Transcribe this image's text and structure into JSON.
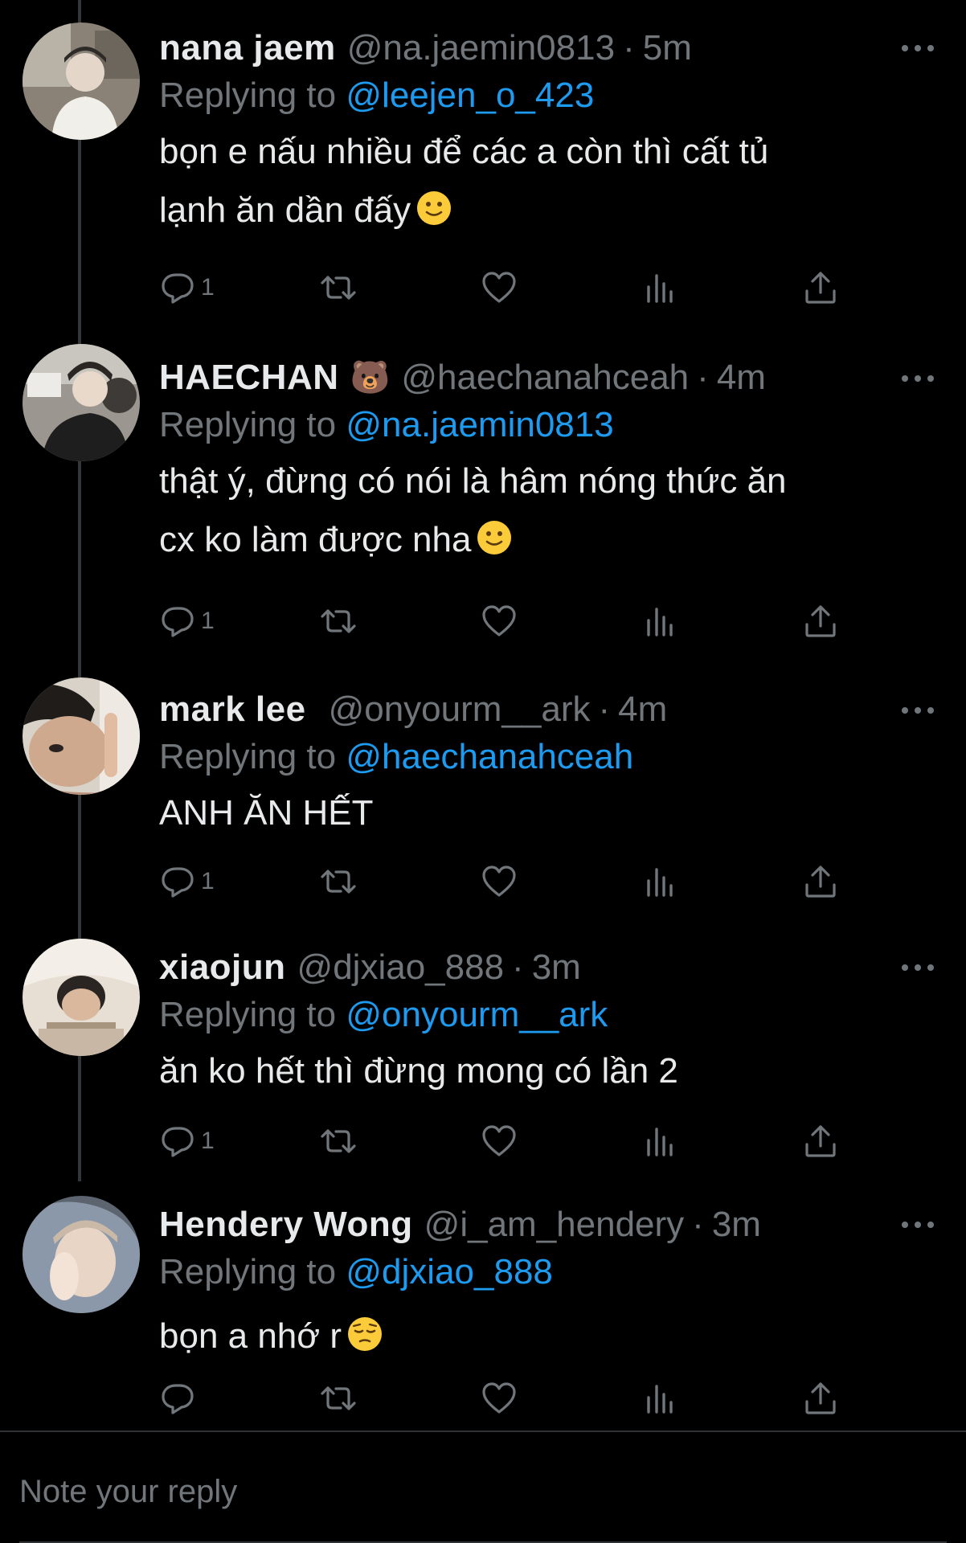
{
  "tweets": [
    {
      "name": "nana jaem",
      "name_emoji": "",
      "handle": "@na.jaemin0813",
      "separator": "·",
      "time": "5m",
      "replying_prefix": "Replying to",
      "replying_to": "@leejen_o_423",
      "text_lines": [
        "bọn e nấu nhiều để các a còn thì cất tủ",
        "lạnh ăn dần đấy"
      ],
      "text_emoji": "slightly-smiling-face",
      "reply_count": "1"
    },
    {
      "name": "HAECHAN",
      "name_emoji": "🐻",
      "handle": "@haechanahceah",
      "separator": "·",
      "time": "4m",
      "replying_prefix": "Replying to",
      "replying_to": "@na.jaemin0813",
      "text_lines": [
        "thật ý, đừng có nói là hâm nóng thức ăn",
        "cx ko làm được nha"
      ],
      "text_emoji": "slightly-smiling-face",
      "reply_count": "1"
    },
    {
      "name": "mark lee",
      "name_emoji": "",
      "handle": "@onyourm__ark",
      "separator": "·",
      "time": "4m",
      "replying_prefix": "Replying to",
      "replying_to": "@haechanahceah",
      "text_lines": [
        "ANH ĂN HẾT"
      ],
      "text_emoji": "",
      "reply_count": "1"
    },
    {
      "name": "xiaojun",
      "name_emoji": "",
      "handle": "@djxiao_888",
      "separator": "·",
      "time": "3m",
      "replying_prefix": "Replying to",
      "replying_to": "@onyourm__ark",
      "text_lines": [
        "ăn ko hết thì đừng mong có lần 2"
      ],
      "text_emoji": "",
      "reply_count": "1"
    },
    {
      "name": "Hendery Wong",
      "name_emoji": "",
      "handle": "@i_am_hendery",
      "separator": "·",
      "time": "3m",
      "replying_prefix": "Replying to",
      "replying_to": "@djxiao_888",
      "text_lines": [
        "bọn a nhớ r"
      ],
      "text_emoji": "pensive-face",
      "reply_count": ""
    }
  ],
  "reply_box": {
    "placeholder": "Note your reply"
  },
  "colors": {
    "background": "#000000",
    "primary_text": "#e7e9ea",
    "secondary_text": "#71767b",
    "link": "#1d9bf0",
    "divider": "#2f3336"
  },
  "icons": [
    "reply-icon",
    "retweet-icon",
    "like-icon",
    "views-icon",
    "share-icon",
    "more-icon"
  ]
}
